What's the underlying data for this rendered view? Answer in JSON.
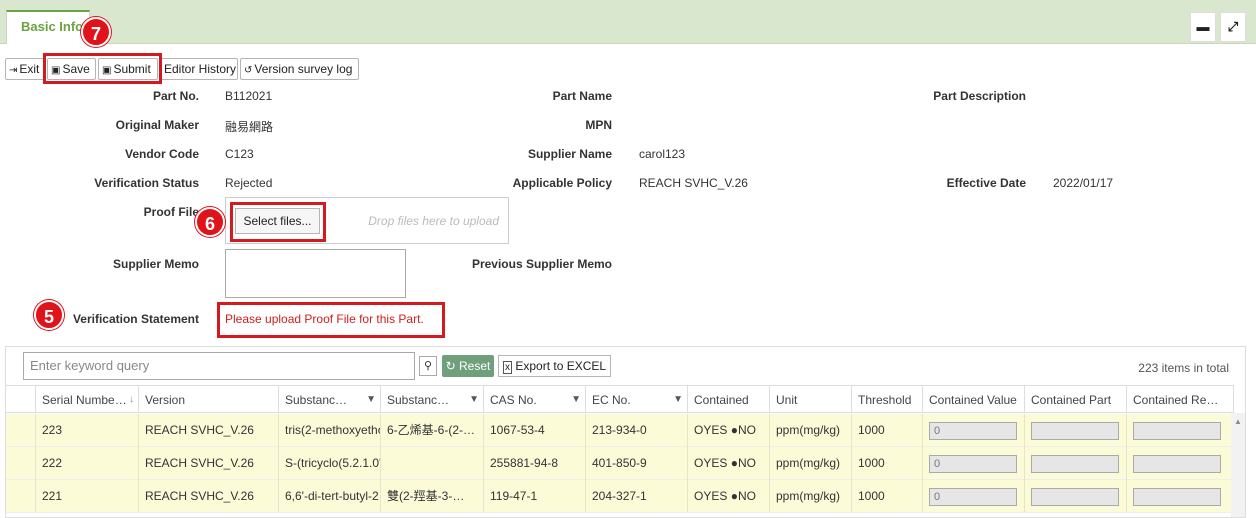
{
  "tab": {
    "label": "Basic Info"
  },
  "window": {
    "minimize": "▬",
    "expand": "⤢"
  },
  "toolbar": {
    "exit": "Exit",
    "save": "Save",
    "submit": "Submit",
    "editor_history": "Editor History",
    "version_survey_log": "Version survey log"
  },
  "badges": {
    "b7": "7",
    "b6": "6",
    "b5": "5"
  },
  "form": {
    "part_no_label": "Part No.",
    "part_no": "B112021",
    "part_name_label": "Part Name",
    "part_description_label": "Part Description",
    "original_maker_label": "Original Maker",
    "original_maker": "融易網路",
    "mpn_label": "MPN",
    "vendor_code_label": "Vendor Code",
    "vendor_code": "C123",
    "supplier_name_label": "Supplier Name",
    "supplier_name": "carol123",
    "verification_status_label": "Verification Status",
    "verification_status": "Rejected",
    "applicable_policy_label": "Applicable Policy",
    "applicable_policy": "REACH SVHC_V.26",
    "effective_date_label": "Effective Date",
    "effective_date": "2022/01/17",
    "proof_file_label": "Proof File",
    "select_files": "Select files...",
    "drop_hint": "Drop files here to upload",
    "supplier_memo_label": "Supplier Memo",
    "previous_supplier_memo_label": "Previous Supplier Memo",
    "verification_statement_label": "Verification Statement",
    "verification_statement": "Please upload Proof File for this Part."
  },
  "grid": {
    "search_placeholder": "Enter keyword query",
    "reset": "Reset",
    "export": "Export to EXCEL",
    "total": "223 items in total",
    "headers": [
      "Serial Numbe…",
      "Version",
      "Substanc…",
      "Substanc…",
      "CAS No.",
      "EC No.",
      "Contained",
      "Unit",
      "Threshold",
      "Contained Value",
      "Contained Part",
      "Contained Re…"
    ],
    "rows": [
      {
        "serial": "223",
        "version": "REACH SVHC_V.26",
        "sub1": "tris(2-methoxyetho",
        "sub2": "6-乙烯基-6-(2-…",
        "cas": "1067-53-4",
        "ec": "213-934-0",
        "yes": "OYES",
        "no": "●NO",
        "unit": "ppm(mg/kg)",
        "threshold": "1000",
        "value": "0"
      },
      {
        "serial": "222",
        "version": "REACH SVHC_V.26",
        "sub1": "S-(tricyclo(5.2.1.0'",
        "sub2": "",
        "cas": "255881-94-8",
        "ec": "401-850-9",
        "yes": "OYES",
        "no": "●NO",
        "unit": "ppm(mg/kg)",
        "threshold": "1000",
        "value": "0"
      },
      {
        "serial": "221",
        "version": "REACH SVHC_V.26",
        "sub1": "6,6'-di-tert-butyl-2",
        "sub2": "雙(2-羥基-3-…",
        "cas": "119-47-1",
        "ec": "204-327-1",
        "yes": "OYES",
        "no": "●NO",
        "unit": "ppm(mg/kg)",
        "threshold": "1000",
        "value": "0"
      }
    ]
  }
}
